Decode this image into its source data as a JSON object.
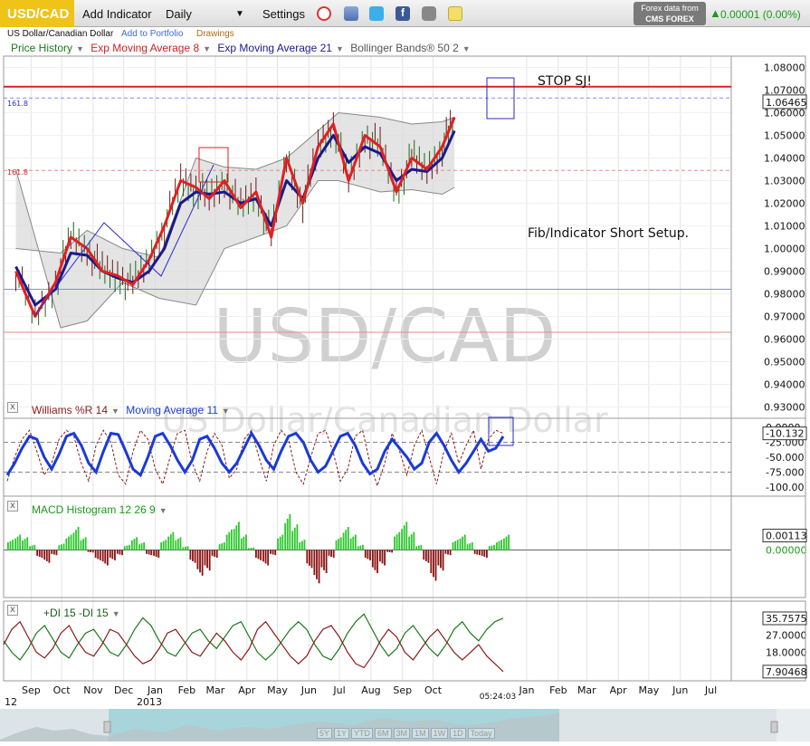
{
  "toolbar": {
    "symbol": "USD/CAD",
    "add_indicator": "Add Indicator",
    "interval": "Daily",
    "settings": "Settings",
    "data_source": "Forex data from",
    "brand": "CMS FOREX",
    "change": "0.00001 (0.00%)",
    "icons": [
      "alarm-clock-icon",
      "database-icon",
      "twitter-icon",
      "facebook-icon",
      "camera-icon",
      "note-icon"
    ]
  },
  "subheader": {
    "name": "US Dollar/Canadian Dollar",
    "add_portfolio": "Add to Portfolio",
    "drawings": "Drawings"
  },
  "watermark": {
    "symbol": "USD/CAD",
    "name": "US Dollar/Canadian Dollar"
  },
  "price_legend": {
    "price_history": "Price History",
    "ema8": "Exp Moving Average 8",
    "ema21": "Exp Moving Average 21",
    "bollinger": "Bollinger Bands® 50 2"
  },
  "annotations": {
    "stop": "STOP SJ!",
    "setup": "Fib/Indicator Short Setup.",
    "fib_upper": "161.8",
    "fib_lower": "161.8"
  },
  "williams_legend": {
    "wr": "Williams %R 14",
    "ma": "Moving Average 11"
  },
  "macd_legend": {
    "title": "MACD Histogram 12 26 9"
  },
  "dmi_legend": {
    "title": "+DI 15 -DI 15"
  },
  "time_axis": {
    "months": [
      "Sep",
      "Oct",
      "Nov",
      "Dec",
      "Jan",
      "Feb",
      "Mar",
      "Apr",
      "May",
      "Jun",
      "Jul",
      "Aug",
      "Sep",
      "Oct",
      "Jan",
      "Feb",
      "Mar",
      "Apr",
      "May",
      "Jun",
      "Jul"
    ],
    "year_start": "12",
    "year_mid": "2013",
    "clock": "05:24:03"
  },
  "navigator": {
    "buttons": [
      "5Y",
      "1Y",
      "YTD",
      "6M",
      "3M",
      "1M",
      "1W",
      "1D",
      "Today"
    ]
  },
  "chart_data": [
    {
      "type": "line",
      "panel": "price",
      "title": "USD/CAD",
      "ylim": [
        0.925,
        1.085
      ],
      "ticks": [
        "1.08000",
        "1.07000",
        "1.06000",
        "1.05000",
        "1.04000",
        "1.03000",
        "1.02000",
        "1.01000",
        "1.00000",
        "0.99000",
        "0.98000",
        "0.97000",
        "0.96000",
        "0.95000",
        "0.94000",
        "0.93000"
      ],
      "tick_values": [
        1.08,
        1.07,
        1.06,
        1.05,
        1.04,
        1.03,
        1.02,
        1.01,
        1.0,
        0.99,
        0.98,
        0.97,
        0.96,
        0.95,
        0.94,
        0.93
      ],
      "last_price": "1.06465",
      "horizontal_lines": {
        "red_line": 1.0715,
        "blue_dashed": 1.0665,
        "red_dashed": 1.0345,
        "blue_solid": 0.982,
        "red_solid": 0.963
      },
      "series": [
        {
          "name": "Exp Moving Average 8",
          "color": "#e02020",
          "x": [
            "2012-09-01",
            "2012-09-20",
            "2012-10-10",
            "2012-10-25",
            "2012-11-10",
            "2012-11-25",
            "2012-12-10",
            "2012-12-25",
            "2013-01-10",
            "2013-01-25",
            "2013-02-10",
            "2013-02-25",
            "2013-03-10",
            "2013-03-25",
            "2013-04-10",
            "2013-04-25",
            "2013-05-10",
            "2013-05-25",
            "2013-06-10",
            "2013-06-25",
            "2013-07-10",
            "2013-07-25",
            "2013-08-10",
            "2013-08-25",
            "2013-09-10",
            "2013-09-25",
            "2013-10-10",
            "2013-10-25",
            "2013-11-06"
          ],
          "values": [
            0.99,
            0.97,
            0.985,
            1.005,
            1.0,
            0.99,
            0.988,
            0.984,
            0.995,
            1.01,
            1.03,
            1.027,
            1.022,
            1.03,
            1.018,
            1.025,
            1.005,
            1.04,
            1.02,
            1.045,
            1.055,
            1.03,
            1.05,
            1.045,
            1.025,
            1.04,
            1.035,
            1.045,
            1.058
          ]
        },
        {
          "name": "Exp Moving Average 21",
          "color": "#1a1a8a",
          "x": [
            "2012-09-01",
            "2012-09-20",
            "2012-10-10",
            "2012-10-25",
            "2012-11-10",
            "2012-11-25",
            "2012-12-10",
            "2012-12-25",
            "2013-01-10",
            "2013-01-25",
            "2013-02-10",
            "2013-02-25",
            "2013-03-10",
            "2013-03-25",
            "2013-04-10",
            "2013-04-25",
            "2013-05-10",
            "2013-05-25",
            "2013-06-10",
            "2013-06-25",
            "2013-07-10",
            "2013-07-25",
            "2013-08-10",
            "2013-08-25",
            "2013-09-10",
            "2013-09-25",
            "2013-10-10",
            "2013-10-25",
            "2013-11-06"
          ],
          "values": [
            0.992,
            0.975,
            0.982,
            0.998,
            0.997,
            0.99,
            0.987,
            0.985,
            0.99,
            1.0,
            1.02,
            1.025,
            1.024,
            1.025,
            1.02,
            1.022,
            1.01,
            1.03,
            1.022,
            1.04,
            1.05,
            1.038,
            1.045,
            1.042,
            1.03,
            1.035,
            1.034,
            1.04,
            1.052
          ]
        },
        {
          "name": "Bollinger Upper",
          "color": "#888",
          "x": [
            "2012-09-01",
            "2012-10-15",
            "2012-11-10",
            "2012-12-15",
            "2013-01-20",
            "2013-02-25",
            "2013-03-25",
            "2013-04-25",
            "2013-05-25",
            "2013-06-25",
            "2013-07-15",
            "2013-08-25",
            "2013-09-25",
            "2013-10-25",
            "2013-11-06"
          ],
          "values": [
            1.0,
            0.998,
            1.008,
            1.0,
            0.996,
            1.04,
            1.036,
            1.035,
            1.04,
            1.052,
            1.06,
            1.058,
            1.055,
            1.056,
            1.058
          ]
        },
        {
          "name": "Bollinger Lower",
          "color": "#888",
          "x": [
            "2012-09-01",
            "2012-10-15",
            "2012-11-10",
            "2012-12-15",
            "2013-01-20",
            "2013-02-25",
            "2013-03-25",
            "2013-04-25",
            "2013-05-25",
            "2013-06-25",
            "2013-07-15",
            "2013-08-25",
            "2013-09-25",
            "2013-10-25",
            "2013-11-06"
          ],
          "values": [
            1.035,
            0.965,
            0.968,
            0.985,
            0.978,
            0.975,
            1.0,
            1.005,
            1.01,
            1.03,
            1.03,
            1.025,
            1.026,
            1.024,
            1.027
          ]
        }
      ]
    },
    {
      "type": "line",
      "panel": "williams",
      "ylim": [
        -100,
        0
      ],
      "ticks": [
        "0.0000",
        "-25.000",
        "-50.000",
        "-75.000",
        "-100.00"
      ],
      "tick_values": [
        0,
        -25,
        -50,
        -75,
        -100
      ],
      "last_value": "-10.132",
      "series": [
        {
          "name": "Moving Average 11",
          "color": "#1a3ad8",
          "values": [
            -80,
            -60,
            -35,
            -15,
            -20,
            -50,
            -70,
            -45,
            -15,
            -10,
            -30,
            -60,
            -75,
            -40,
            -10,
            -12,
            -40,
            -70,
            -80,
            -50,
            -15,
            -10,
            -30,
            -55,
            -75,
            -55,
            -20,
            -15,
            -35,
            -60,
            -75,
            -60,
            -35,
            -10,
            -30,
            -55,
            -70,
            -40,
            -15,
            -10,
            -25,
            -55,
            -75,
            -65,
            -40,
            -15,
            -10,
            -30,
            -60,
            -78,
            -70,
            -40,
            -20,
            -35,
            -50,
            -70,
            -60,
            -25,
            -10,
            -30,
            -55,
            -75,
            -60,
            -40,
            -20,
            -40,
            -35,
            -15
          ]
        },
        {
          "name": "Williams %R 14",
          "color": "#8a1a1a",
          "values": [
            -90,
            -50,
            -20,
            -5,
            -40,
            -80,
            -60,
            -20,
            -5,
            -15,
            -60,
            -90,
            -30,
            -5,
            -25,
            -80,
            -95,
            -40,
            -5,
            -20,
            -70,
            -95,
            -50,
            -10,
            -5,
            -60,
            -90,
            -40,
            -10,
            -30,
            -85,
            -70,
            -20,
            -5,
            -50,
            -90,
            -30,
            -5,
            -20,
            -75,
            -95,
            -50,
            -10,
            -5,
            -40,
            -90,
            -70,
            -15,
            -5,
            -60,
            -98,
            -60,
            -10,
            -40,
            -80,
            -30,
            -5,
            -50,
            -95,
            -40,
            -10,
            -60,
            -30,
            -5,
            -70,
            -20,
            -5,
            -10
          ]
        }
      ]
    },
    {
      "type": "bar",
      "panel": "macd",
      "ylim": [
        -0.003,
        0.0035
      ],
      "ticks": [
        "0.00113",
        "0.00000"
      ],
      "tick_values": [
        0.00113,
        0
      ],
      "last_value": "0.00113",
      "positive_color": "#2ac82a",
      "negative_color": "#8a1010",
      "values": [
        0.0008,
        0.0012,
        0.001,
        0.0004,
        -0.0006,
        -0.001,
        -0.0004,
        0.0005,
        0.0012,
        0.0018,
        0.001,
        -0.0002,
        -0.0008,
        -0.0012,
        -0.0008,
        -0.0004,
        0.0004,
        0.001,
        0.0006,
        -0.0004,
        -0.0006,
        0.0008,
        0.0014,
        0.001,
        0.0003,
        -0.001,
        -0.002,
        -0.0016,
        -0.0006,
        0.0006,
        0.0016,
        0.0022,
        0.0012,
        0.0002,
        -0.0008,
        -0.0012,
        -0.0004,
        0.0012,
        0.0028,
        0.002,
        0.0008,
        -0.0014,
        -0.0026,
        -0.0018,
        -0.0006,
        0.001,
        0.0018,
        0.0012,
        0.0004,
        -0.0008,
        -0.0018,
        -0.0012,
        -0.0002,
        0.0014,
        0.0022,
        0.0014,
        0.0004,
        -0.001,
        -0.0024,
        -0.0016,
        -0.0004,
        0.0008,
        0.0012,
        0.0006,
        -0.0004,
        -0.0006,
        0.0004,
        0.0008,
        0.0012
      ]
    },
    {
      "type": "line",
      "panel": "dmi",
      "ylim": [
        5,
        40
      ],
      "ticks": [
        "35.7575",
        "27.0000",
        "18.0000",
        "7.90468"
      ],
      "tick_values": [
        35.7575,
        27,
        18,
        7.90468
      ],
      "series": [
        {
          "name": "+DI 15",
          "color": "#1a7a1a",
          "values": [
            24,
            18,
            14,
            20,
            28,
            32,
            25,
            18,
            15,
            22,
            28,
            30,
            24,
            18,
            16,
            22,
            30,
            36,
            32,
            24,
            18,
            16,
            22,
            28,
            30,
            24,
            20,
            26,
            32,
            34,
            26,
            18,
            14,
            18,
            24,
            30,
            34,
            30,
            22,
            16,
            14,
            20,
            28,
            34,
            38,
            30,
            22,
            16,
            20,
            28,
            32,
            26,
            20,
            16,
            22,
            30,
            34,
            28,
            24,
            30,
            34,
            35.76
          ]
        },
        {
          "name": "-DI 15",
          "color": "#8a1a1a",
          "values": [
            22,
            30,
            34,
            26,
            18,
            15,
            20,
            28,
            32,
            24,
            18,
            16,
            22,
            30,
            28,
            22,
            16,
            12,
            14,
            20,
            28,
            30,
            24,
            18,
            16,
            22,
            28,
            24,
            18,
            14,
            20,
            30,
            34,
            28,
            22,
            16,
            12,
            16,
            24,
            30,
            32,
            26,
            18,
            12,
            10,
            16,
            24,
            30,
            26,
            18,
            14,
            20,
            26,
            30,
            24,
            18,
            14,
            18,
            22,
            16,
            12,
            7.9
          ]
        }
      ]
    }
  ]
}
